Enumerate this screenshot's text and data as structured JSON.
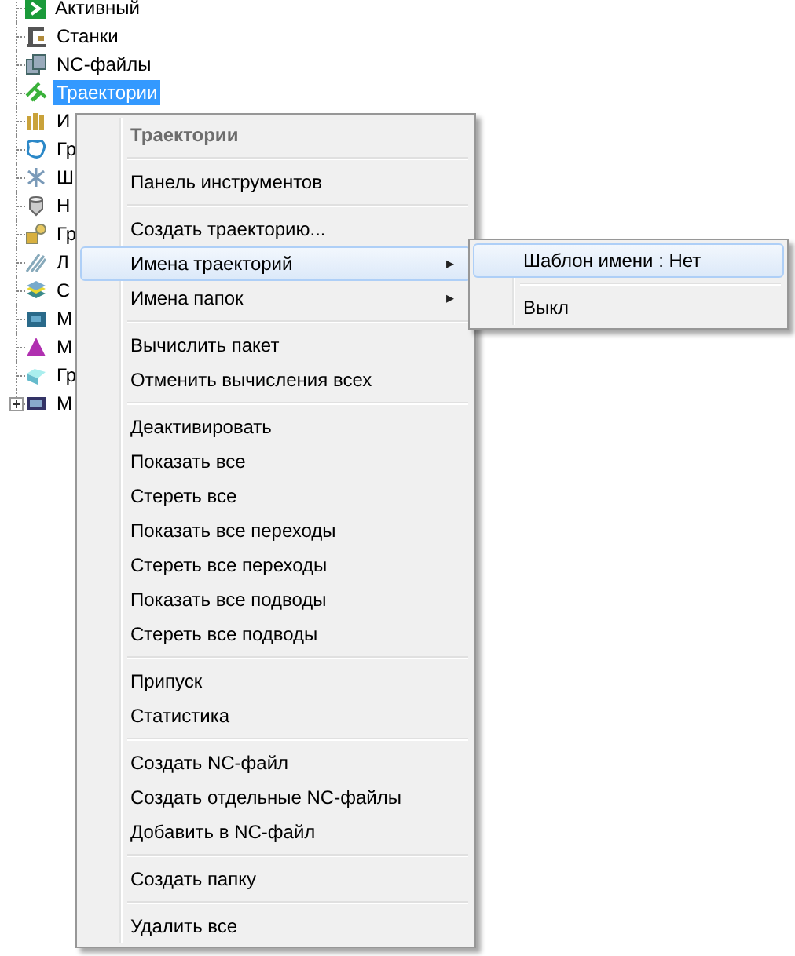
{
  "tree": {
    "items": [
      {
        "label": "Активный",
        "selected": false,
        "expandable": false
      },
      {
        "label": "Станки",
        "selected": false,
        "expandable": false
      },
      {
        "label": "NC-файлы",
        "selected": false,
        "expandable": false
      },
      {
        "label": "Траектории",
        "selected": true,
        "expandable": false
      },
      {
        "label": "И",
        "selected": false,
        "expandable": false
      },
      {
        "label": "Гр",
        "selected": false,
        "expandable": false
      },
      {
        "label": "Ш",
        "selected": false,
        "expandable": false
      },
      {
        "label": "Н",
        "selected": false,
        "expandable": false
      },
      {
        "label": "Гр",
        "selected": false,
        "expandable": false
      },
      {
        "label": "Л",
        "selected": false,
        "expandable": false
      },
      {
        "label": "С",
        "selected": false,
        "expandable": false
      },
      {
        "label": "М",
        "selected": false,
        "expandable": false
      },
      {
        "label": "М",
        "selected": false,
        "expandable": false
      },
      {
        "label": "Гр",
        "selected": false,
        "expandable": false
      },
      {
        "label": "М",
        "selected": false,
        "expandable": true
      }
    ]
  },
  "context_menu": {
    "items": [
      {
        "kind": "header",
        "label": "Траектории"
      },
      {
        "kind": "separator"
      },
      {
        "kind": "item",
        "label": "Панель инструментов",
        "selected": false
      },
      {
        "kind": "separator"
      },
      {
        "kind": "item",
        "label": "Создать траекторию...",
        "selected": false
      },
      {
        "kind": "submenu",
        "label": "Имена траекторий",
        "arrow": "▸",
        "selected": true
      },
      {
        "kind": "submenu",
        "label": "Имена папок",
        "arrow": "▸",
        "selected": false
      },
      {
        "kind": "separator"
      },
      {
        "kind": "item",
        "label": "Вычислить пакет",
        "selected": false
      },
      {
        "kind": "item",
        "label": "Отменить вычисления всех",
        "selected": false
      },
      {
        "kind": "separator"
      },
      {
        "kind": "item",
        "label": "Деактивировать",
        "selected": false
      },
      {
        "kind": "item",
        "label": "Показать все",
        "selected": false
      },
      {
        "kind": "item",
        "label": "Стереть все",
        "selected": false
      },
      {
        "kind": "item",
        "label": "Показать все переходы",
        "selected": false
      },
      {
        "kind": "item",
        "label": "Стереть все переходы",
        "selected": false
      },
      {
        "kind": "item",
        "label": "Показать все подводы",
        "selected": false
      },
      {
        "kind": "item",
        "label": "Стереть все подводы",
        "selected": false
      },
      {
        "kind": "separator"
      },
      {
        "kind": "item",
        "label": "Припуск",
        "selected": false
      },
      {
        "kind": "item",
        "label": "Статистика",
        "selected": false
      },
      {
        "kind": "separator"
      },
      {
        "kind": "item",
        "label": "Создать NC-файл",
        "selected": false
      },
      {
        "kind": "item",
        "label": "Создать отдельные NC-файлы",
        "selected": false
      },
      {
        "kind": "item",
        "label": "Добавить в NC-файл",
        "selected": false
      },
      {
        "kind": "separator"
      },
      {
        "kind": "item",
        "label": "Создать папку",
        "selected": false
      },
      {
        "kind": "separator"
      },
      {
        "kind": "item",
        "label": "Удалить все",
        "selected": false
      }
    ]
  },
  "submenu": {
    "items": [
      {
        "kind": "item",
        "label": "Шаблон имени : Нет",
        "selected": true
      },
      {
        "kind": "separator"
      },
      {
        "kind": "item",
        "label": "Выкл",
        "selected": false
      }
    ]
  }
}
